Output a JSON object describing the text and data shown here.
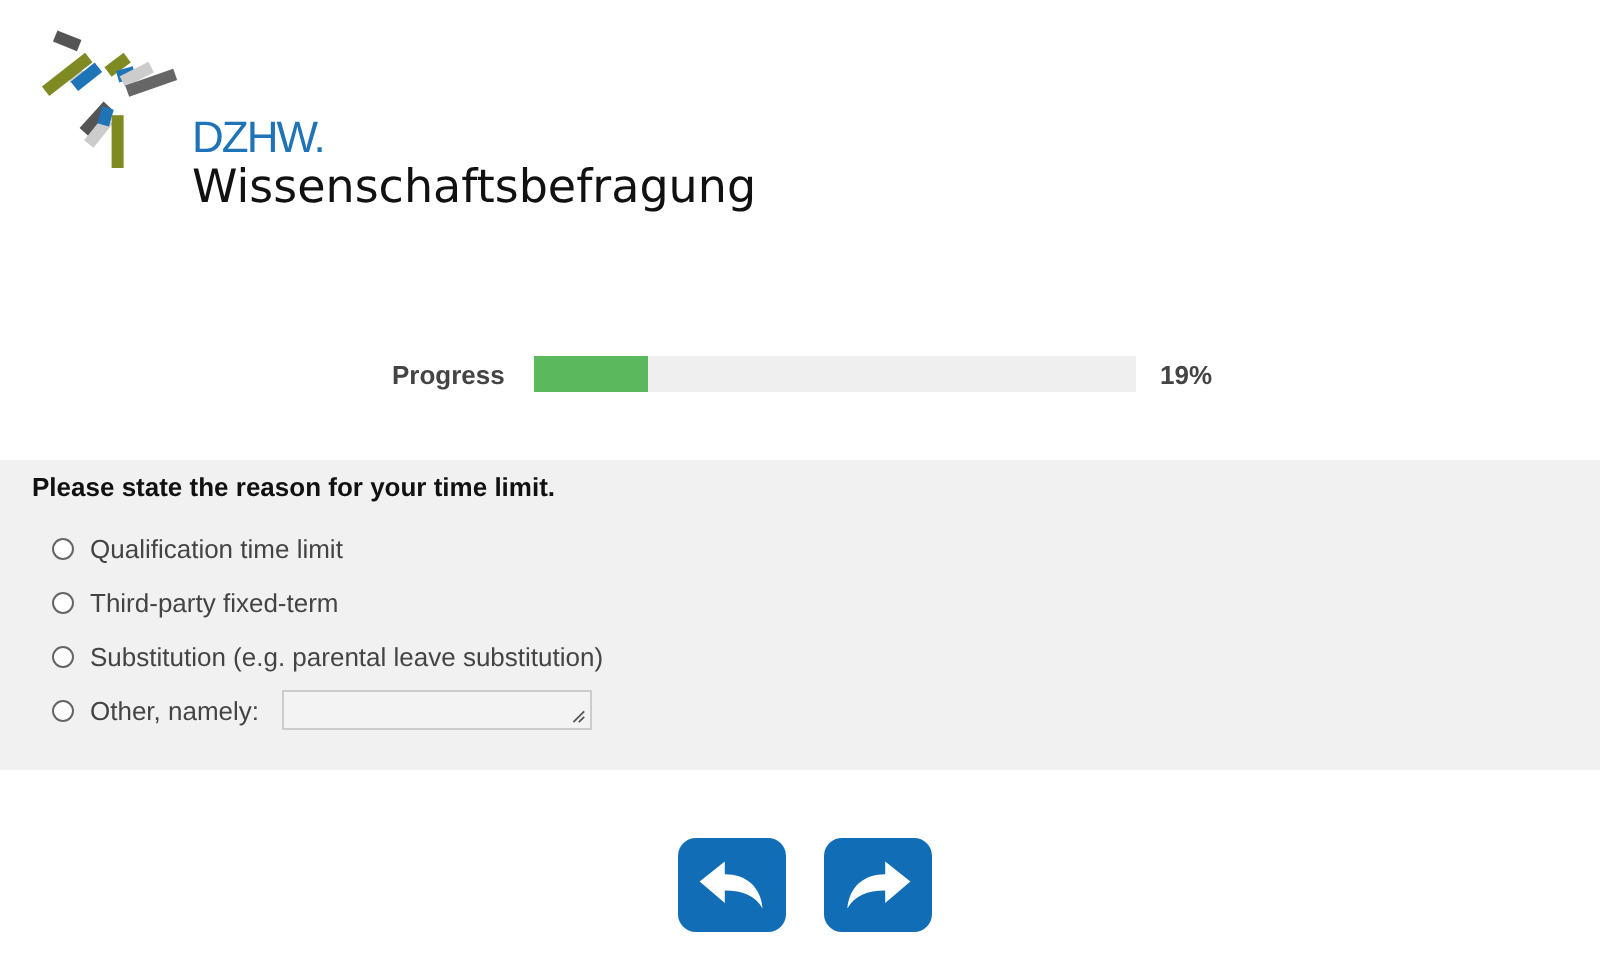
{
  "logo": {
    "acronym": "DZHW.",
    "name": "Wissenschaftsbefragung"
  },
  "progress": {
    "label": "Progress",
    "level": 0.19,
    "reading": "19%"
  },
  "question": {
    "text": "Please state the reason for your time limit.",
    "options": [
      {
        "kind": "radio",
        "label": "Qualification time limit",
        "selected": false
      },
      {
        "kind": "radio",
        "label": "Third-party fixed-term",
        "selected": false
      },
      {
        "kind": "radio",
        "label": "Substitution (e.g. parental leave substitution)",
        "selected": false
      },
      {
        "kind": "radio-text",
        "label": "Other, namely:",
        "selected": false
      }
    ]
  },
  "navigation": [
    {
      "kind": "back"
    },
    {
      "kind": "next"
    }
  ]
}
